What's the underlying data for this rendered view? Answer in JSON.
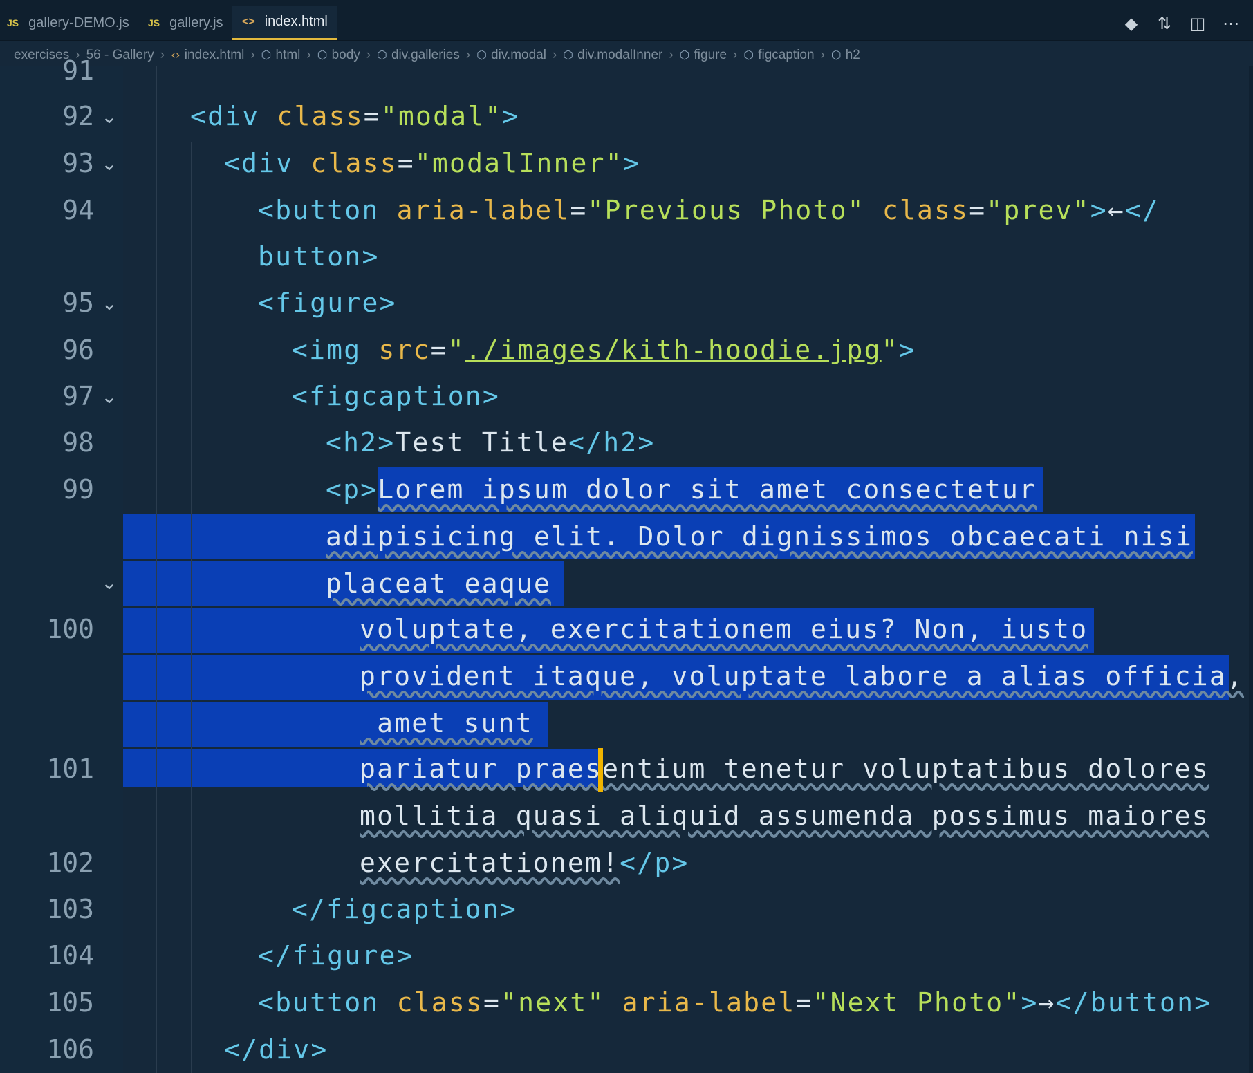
{
  "tabs": [
    {
      "icon": "JS",
      "label": "gallery-DEMO.js",
      "active": false
    },
    {
      "icon": "JS",
      "label": "gallery.js",
      "active": false
    },
    {
      "icon": "<>",
      "label": "index.html",
      "active": true
    }
  ],
  "toolbar_icons": [
    "source-control-icon",
    "compare-changes-icon",
    "split-editor-icon",
    "more-actions-icon"
  ],
  "breadcrumb": [
    "exercises",
    "56 - Gallery",
    "index.html",
    "html",
    "body",
    "div.galleries",
    "div.modal",
    "div.modalInner",
    "figure",
    "figcaption",
    "h2"
  ],
  "editor": {
    "line_numbers": [
      "91",
      "92",
      "93",
      "94",
      "95",
      "96",
      "97",
      "98",
      "99",
      "100",
      "101",
      "102",
      "103",
      "104",
      "105",
      "106"
    ],
    "lines": {
      "l92": {
        "t1": "<div ",
        "a1": "class",
        "eq": "=",
        "s1": "\"modal\"",
        "t2": ">"
      },
      "l93": {
        "t1": "<div ",
        "a1": "class",
        "eq": "=",
        "s1": "\"modalInner\"",
        "t2": ">"
      },
      "l94": {
        "t1": "<button ",
        "a1": "aria-label",
        "eq": "=",
        "s1": "\"Previous Photo\"",
        "sp": " ",
        "a2": "class",
        "eq2": "=",
        "s2": "\"prev\"",
        "t2": ">",
        "txt": "←",
        "t3": "</"
      },
      "l94b": {
        "t1": "button>"
      },
      "l95": {
        "t1": "<figure>"
      },
      "l96": {
        "t1": "<img ",
        "a1": "src",
        "eq": "=",
        "q1": "\"",
        "u1": "./images/kith-hoodie.jpg",
        "q2": "\"",
        "t2": ">"
      },
      "l97": {
        "t1": "<figcaption>"
      },
      "l98": {
        "t1": "<h2>",
        "txt": "Test Title",
        "t2": "</h2>"
      },
      "l99": {
        "t1": "<p>",
        "txt": "Lorem ipsum dolor sit amet consectetur"
      },
      "l99b": {
        "txt": "adipisicing elit. Dolor dignissimos obcaecati nisi"
      },
      "l99c": {
        "txt": "placeat eaque"
      },
      "l100": {
        "txt": "voluptate, exercitationem eius? Non, iusto"
      },
      "l100b": {
        "txt": "provident itaque, voluptate labore a alias officia,"
      },
      "l100c": {
        "txt": " amet sunt"
      },
      "l101a": {
        "txt": "pariatur praes"
      },
      "l101b": {
        "txt": "entium tenetur voluptatibus dolores"
      },
      "l101c": {
        "txt": "mollitia quasi aliquid assumenda possimus maiores"
      },
      "l102": {
        "txt": "exercitationem!",
        "t2": "</p>"
      },
      "l103": {
        "t1": "</figcaption>"
      },
      "l104": {
        "t1": "</figure>"
      },
      "l105": {
        "t1": "<button ",
        "a1": "class",
        "eq": "=",
        "s1": "\"next\"",
        "sp": " ",
        "a2": "aria-label",
        "eq2": "=",
        "s2": "\"Next Photo\"",
        "t2": ">",
        "txt": "→",
        "t3": "</button>"
      },
      "l106": {
        "t1": "</div>"
      }
    }
  },
  "colors": {
    "background": "#15283a",
    "selection": "#0a3fb5",
    "tag": "#64c7e8",
    "attribute": "#e8b84a",
    "string": "#b7df5a",
    "cursor": "#f0b400"
  }
}
